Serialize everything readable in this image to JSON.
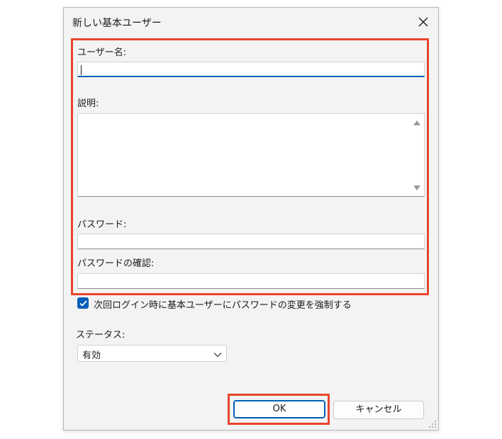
{
  "dialog": {
    "title": "新しい基本ユーザー",
    "close_icon": "close-icon"
  },
  "fields": {
    "username_label": "ユーザー名:",
    "username_value": "",
    "description_label": "説明:",
    "password_label": "パスワード:",
    "password_confirm_label": "パスワードの確認:"
  },
  "options": {
    "force_change_label": "次回ログイン時に基本ユーザーにパスワードの変更を強制する",
    "force_change_checked": true
  },
  "status": {
    "label": "ステータス:",
    "selected": "有効"
  },
  "buttons": {
    "ok": "OK",
    "cancel": "キャンセル"
  },
  "colors": {
    "accent": "#005fb8",
    "highlight": "#e8452c",
    "dialog_bg": "#f3f3f3"
  }
}
